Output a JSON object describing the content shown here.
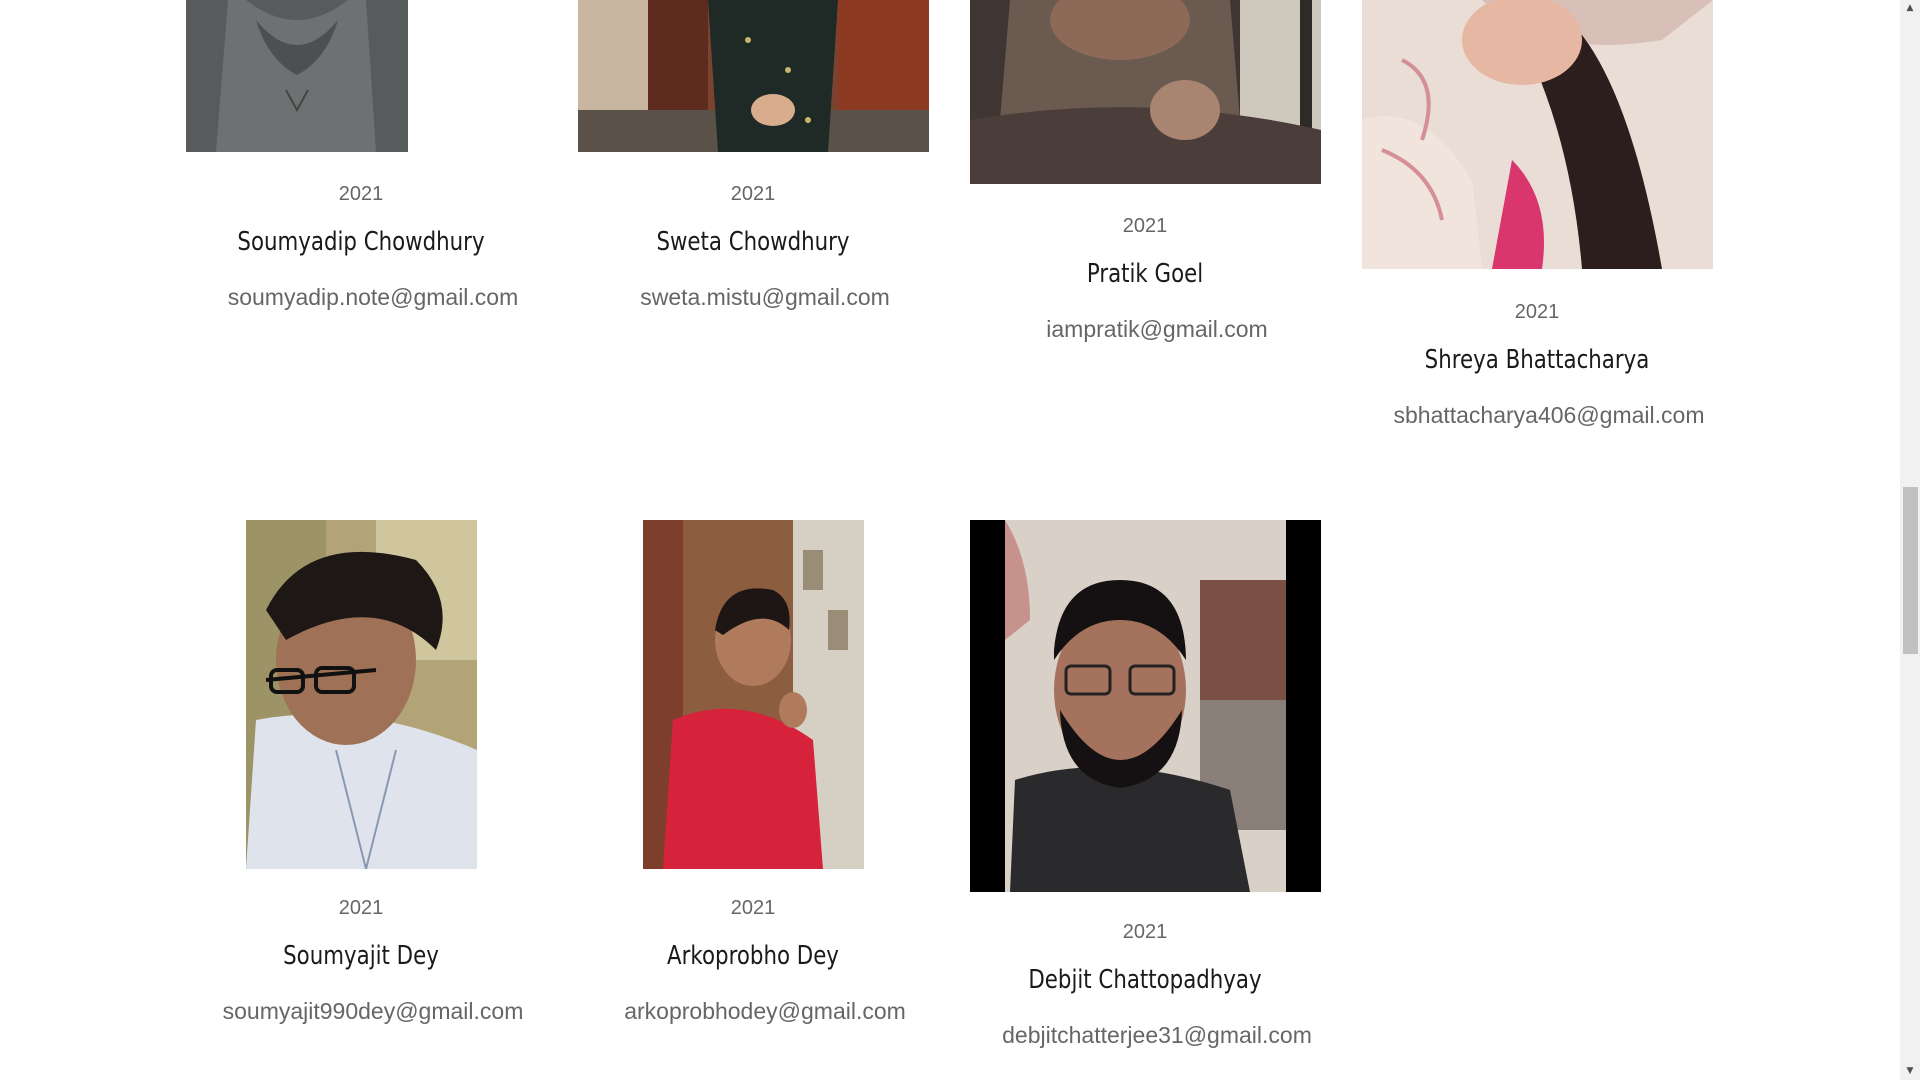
{
  "members": [
    {
      "year": "2021",
      "name": "Soumyadip Chowdhury",
      "email": "soumyadip.note@gmail.com",
      "photo_icon": "portrait-photo"
    },
    {
      "year": "2021",
      "name": "Sweta Chowdhury",
      "email": "sweta.mistu@gmail.com",
      "photo_icon": "portrait-photo"
    },
    {
      "year": "2021",
      "name": "Pratik Goel",
      "email": "iampratik@gmail.com",
      "photo_icon": "portrait-photo"
    },
    {
      "year": "2021",
      "name": "Shreya Bhattacharya",
      "email": "sbhattacharya406@gmail.com",
      "photo_icon": "portrait-photo"
    },
    {
      "year": "2021",
      "name": "Soumyajit Dey",
      "email": "soumyajit990dey@gmail.com",
      "photo_icon": "portrait-photo"
    },
    {
      "year": "2021",
      "name": "Arkoprobho Dey",
      "email": "arkoprobhodey@gmail.com",
      "photo_icon": "portrait-photo"
    },
    {
      "year": "2021",
      "name": "Debjit Chattopadhyay",
      "email": "debjitchatterjee31@gmail.com",
      "photo_icon": "portrait-photo"
    }
  ],
  "scrollbar": {
    "up_icon": "scroll-up-arrow-icon",
    "down_icon": "scroll-down-arrow-icon",
    "position_fraction": 0.46
  }
}
